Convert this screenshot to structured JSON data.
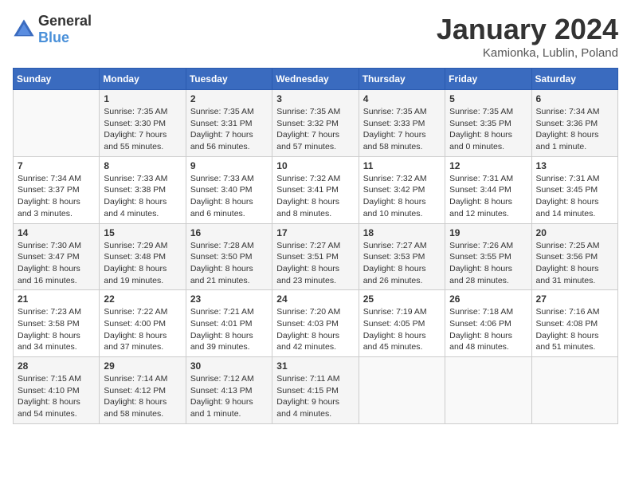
{
  "header": {
    "logo_general": "General",
    "logo_blue": "Blue",
    "month": "January 2024",
    "location": "Kamionka, Lublin, Poland"
  },
  "days_of_week": [
    "Sunday",
    "Monday",
    "Tuesday",
    "Wednesday",
    "Thursday",
    "Friday",
    "Saturday"
  ],
  "weeks": [
    [
      {
        "day": "",
        "content": ""
      },
      {
        "day": "1",
        "content": "Sunrise: 7:35 AM\nSunset: 3:30 PM\nDaylight: 7 hours\nand 55 minutes."
      },
      {
        "day": "2",
        "content": "Sunrise: 7:35 AM\nSunset: 3:31 PM\nDaylight: 7 hours\nand 56 minutes."
      },
      {
        "day": "3",
        "content": "Sunrise: 7:35 AM\nSunset: 3:32 PM\nDaylight: 7 hours\nand 57 minutes."
      },
      {
        "day": "4",
        "content": "Sunrise: 7:35 AM\nSunset: 3:33 PM\nDaylight: 7 hours\nand 58 minutes."
      },
      {
        "day": "5",
        "content": "Sunrise: 7:35 AM\nSunset: 3:35 PM\nDaylight: 8 hours\nand 0 minutes."
      },
      {
        "day": "6",
        "content": "Sunrise: 7:34 AM\nSunset: 3:36 PM\nDaylight: 8 hours\nand 1 minute."
      }
    ],
    [
      {
        "day": "7",
        "content": "Sunrise: 7:34 AM\nSunset: 3:37 PM\nDaylight: 8 hours\nand 3 minutes."
      },
      {
        "day": "8",
        "content": "Sunrise: 7:33 AM\nSunset: 3:38 PM\nDaylight: 8 hours\nand 4 minutes."
      },
      {
        "day": "9",
        "content": "Sunrise: 7:33 AM\nSunset: 3:40 PM\nDaylight: 8 hours\nand 6 minutes."
      },
      {
        "day": "10",
        "content": "Sunrise: 7:32 AM\nSunset: 3:41 PM\nDaylight: 8 hours\nand 8 minutes."
      },
      {
        "day": "11",
        "content": "Sunrise: 7:32 AM\nSunset: 3:42 PM\nDaylight: 8 hours\nand 10 minutes."
      },
      {
        "day": "12",
        "content": "Sunrise: 7:31 AM\nSunset: 3:44 PM\nDaylight: 8 hours\nand 12 minutes."
      },
      {
        "day": "13",
        "content": "Sunrise: 7:31 AM\nSunset: 3:45 PM\nDaylight: 8 hours\nand 14 minutes."
      }
    ],
    [
      {
        "day": "14",
        "content": "Sunrise: 7:30 AM\nSunset: 3:47 PM\nDaylight: 8 hours\nand 16 minutes."
      },
      {
        "day": "15",
        "content": "Sunrise: 7:29 AM\nSunset: 3:48 PM\nDaylight: 8 hours\nand 19 minutes."
      },
      {
        "day": "16",
        "content": "Sunrise: 7:28 AM\nSunset: 3:50 PM\nDaylight: 8 hours\nand 21 minutes."
      },
      {
        "day": "17",
        "content": "Sunrise: 7:27 AM\nSunset: 3:51 PM\nDaylight: 8 hours\nand 23 minutes."
      },
      {
        "day": "18",
        "content": "Sunrise: 7:27 AM\nSunset: 3:53 PM\nDaylight: 8 hours\nand 26 minutes."
      },
      {
        "day": "19",
        "content": "Sunrise: 7:26 AM\nSunset: 3:55 PM\nDaylight: 8 hours\nand 28 minutes."
      },
      {
        "day": "20",
        "content": "Sunrise: 7:25 AM\nSunset: 3:56 PM\nDaylight: 8 hours\nand 31 minutes."
      }
    ],
    [
      {
        "day": "21",
        "content": "Sunrise: 7:23 AM\nSunset: 3:58 PM\nDaylight: 8 hours\nand 34 minutes."
      },
      {
        "day": "22",
        "content": "Sunrise: 7:22 AM\nSunset: 4:00 PM\nDaylight: 8 hours\nand 37 minutes."
      },
      {
        "day": "23",
        "content": "Sunrise: 7:21 AM\nSunset: 4:01 PM\nDaylight: 8 hours\nand 39 minutes."
      },
      {
        "day": "24",
        "content": "Sunrise: 7:20 AM\nSunset: 4:03 PM\nDaylight: 8 hours\nand 42 minutes."
      },
      {
        "day": "25",
        "content": "Sunrise: 7:19 AM\nSunset: 4:05 PM\nDaylight: 8 hours\nand 45 minutes."
      },
      {
        "day": "26",
        "content": "Sunrise: 7:18 AM\nSunset: 4:06 PM\nDaylight: 8 hours\nand 48 minutes."
      },
      {
        "day": "27",
        "content": "Sunrise: 7:16 AM\nSunset: 4:08 PM\nDaylight: 8 hours\nand 51 minutes."
      }
    ],
    [
      {
        "day": "28",
        "content": "Sunrise: 7:15 AM\nSunset: 4:10 PM\nDaylight: 8 hours\nand 54 minutes."
      },
      {
        "day": "29",
        "content": "Sunrise: 7:14 AM\nSunset: 4:12 PM\nDaylight: 8 hours\nand 58 minutes."
      },
      {
        "day": "30",
        "content": "Sunrise: 7:12 AM\nSunset: 4:13 PM\nDaylight: 9 hours\nand 1 minute."
      },
      {
        "day": "31",
        "content": "Sunrise: 7:11 AM\nSunset: 4:15 PM\nDaylight: 9 hours\nand 4 minutes."
      },
      {
        "day": "",
        "content": ""
      },
      {
        "day": "",
        "content": ""
      },
      {
        "day": "",
        "content": ""
      }
    ]
  ]
}
